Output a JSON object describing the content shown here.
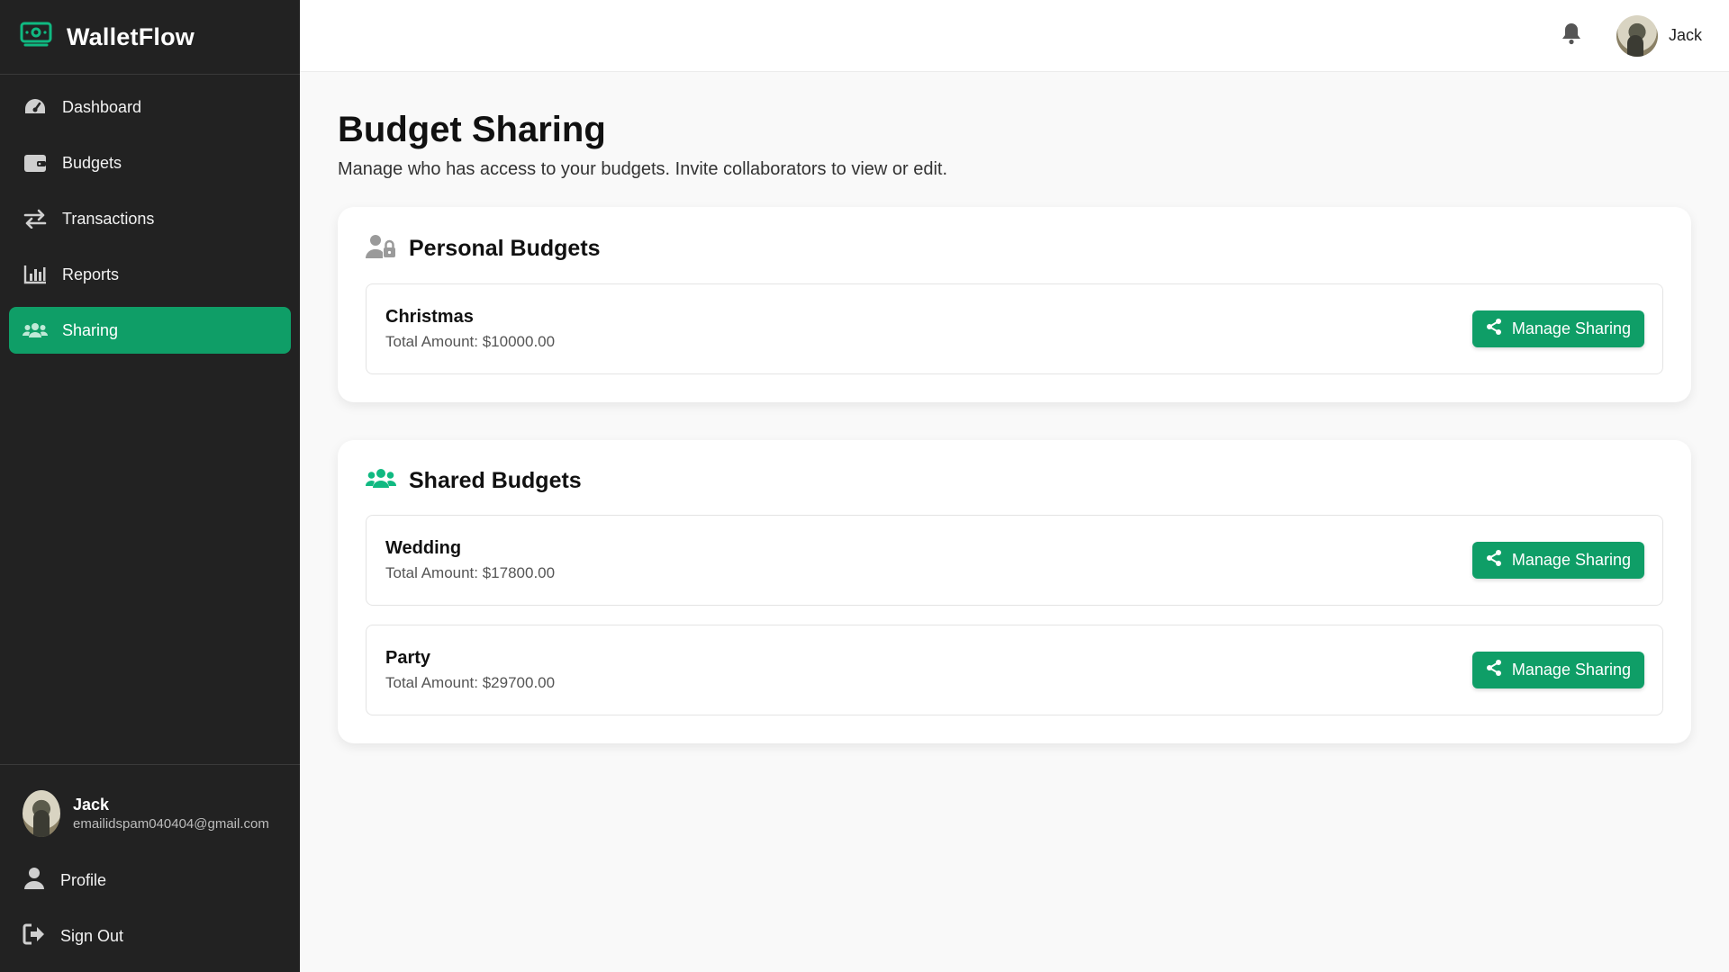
{
  "brand": {
    "name": "WalletFlow",
    "icon": "money-bill-icon",
    "accent": "#0f9e67"
  },
  "nav": [
    {
      "label": "Dashboard",
      "icon": "gauge-icon"
    },
    {
      "label": "Budgets",
      "icon": "wallet-icon"
    },
    {
      "label": "Transactions",
      "icon": "arrows-exchange-icon"
    },
    {
      "label": "Reports",
      "icon": "bar-chart-icon"
    },
    {
      "label": "Sharing",
      "icon": "users-icon",
      "active": true
    }
  ],
  "sidebar_user": {
    "name": "Jack",
    "email": "emailidspam040404@gmail.com"
  },
  "footer": {
    "profile": "Profile",
    "sign_out": "Sign Out"
  },
  "topbar": {
    "user_name": "Jack",
    "bell_icon": "bell-icon"
  },
  "page": {
    "title": "Budget Sharing",
    "subtitle": "Manage who has access to your budgets. Invite collaborators to view or edit."
  },
  "personal": {
    "title": "Personal Budgets",
    "icon": "user-lock-icon",
    "items": [
      {
        "name": "Christmas",
        "amount": "Total Amount: $10000.00",
        "button": "Manage Sharing"
      }
    ]
  },
  "shared": {
    "title": "Shared Budgets",
    "icon": "users-icon",
    "items": [
      {
        "name": "Wedding",
        "amount": "Total Amount: $17800.00",
        "button": "Manage Sharing"
      },
      {
        "name": "Party",
        "amount": "Total Amount: $29700.00",
        "button": "Manage Sharing"
      }
    ]
  }
}
